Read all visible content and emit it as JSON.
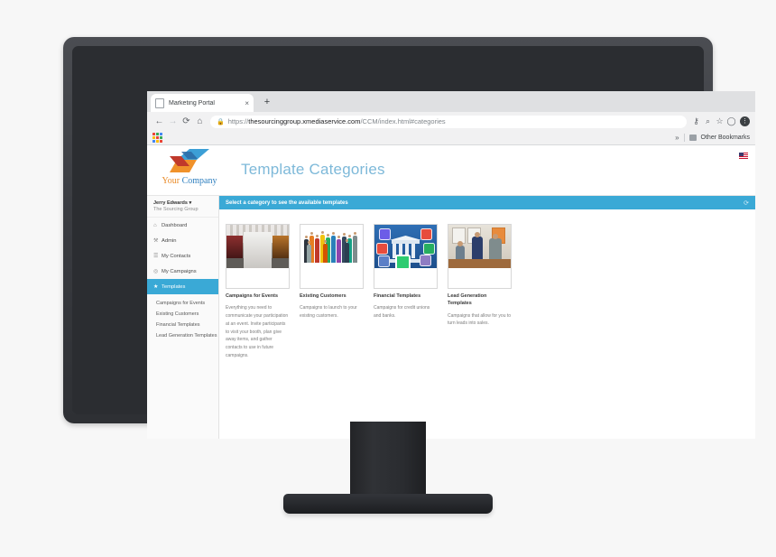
{
  "browser": {
    "tab": {
      "title": "Marketing Portal",
      "close_label": "×"
    },
    "new_tab_label": "+",
    "nav": {
      "back": "←",
      "forward": "→",
      "reload": "⟳",
      "home": "⌂"
    },
    "omnibox": {
      "lock_icon": "ὑ2",
      "url_scheme": "https://",
      "url_domain": "thesourcinggroup.xmediaservice.com",
      "url_path": "/CCM/index.html#categories",
      "full_url": "https://thesourcinggroup.xmediaservice.com/CCM/index.html#categories"
    },
    "toolbar_icons": {
      "key": "⚷",
      "search": "⌕",
      "star": "☆",
      "profile": "◯",
      "menu": "⋮"
    },
    "bookmarks": {
      "apps_grid_colors": [
        "#ea4335",
        "#34a853",
        "#4285f4",
        "#fbbc05",
        "#ea4335",
        "#34a853",
        "#4285f4",
        "#fbbc05",
        "#ea4335"
      ],
      "chevron": "»",
      "other_bookmarks": "Other Bookmarks"
    }
  },
  "app": {
    "brand": {
      "company_first": "Your",
      "company_second": "Company",
      "logo_name": "cube-logo"
    },
    "page_title": "Template Categories",
    "locale_flag": "US",
    "banner": {
      "text": "Select a category to see the available templates",
      "refresh_icon": "⟳"
    },
    "sidebar": {
      "user": {
        "name": "Jerry Edwards",
        "caret": "▾",
        "org": "The Sourcing Group"
      },
      "items": [
        {
          "label": "Dashboard",
          "icon": "⌂",
          "icon_name": "home-icon",
          "active": false
        },
        {
          "label": "Admin",
          "icon": "⚒",
          "icon_name": "wrench-icon",
          "active": false
        },
        {
          "label": "My Contacts",
          "icon": "☰",
          "icon_name": "contacts-icon",
          "active": false
        },
        {
          "label": "My Campaigns",
          "icon": "◎",
          "icon_name": "target-icon",
          "active": false
        },
        {
          "label": "Templates",
          "icon": "★",
          "icon_name": "star-icon",
          "active": true
        }
      ],
      "sub_items": [
        {
          "label": "Campaigns for Events"
        },
        {
          "label": "Existing Customers"
        },
        {
          "label": "Financial Templates"
        },
        {
          "label": "Lead Generation Templates"
        }
      ]
    },
    "cards": [
      {
        "title": "Campaigns for Events",
        "description": "Everything you need to communicate your participation at an event. Invite participants to visit your booth, plan give away items, and gather contacts to use in future campaigns.",
        "thumb_name": "tradeshow-hall-photo"
      },
      {
        "title": "Existing Customers",
        "description": "Campaigns to launch to your existing customers.",
        "thumb_name": "business-crowd-photo"
      },
      {
        "title": "Financial Templates",
        "description": "Campaigns for credit unions and banks.",
        "thumb_name": "bank-icons-illustration"
      },
      {
        "title": "Lead Generation Templates",
        "description": "Campaigns that allow for you to turn leads into sales.",
        "thumb_name": "office-meeting-photo"
      }
    ]
  },
  "colors": {
    "accent": "#3aa9d6",
    "title": "#7eb9d9",
    "brand_orange": "#e98b28",
    "brand_blue": "#2e7fbf",
    "page_bg": "#f7f7f7"
  }
}
